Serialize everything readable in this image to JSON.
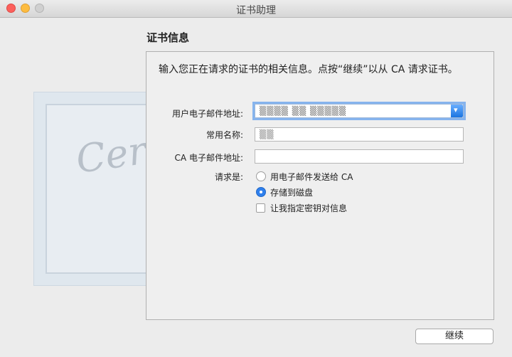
{
  "window": {
    "title": "证书助理"
  },
  "section": {
    "title": "证书信息"
  },
  "intro": "输入您正在请求的证书的相关信息。点按“继续”以从 CA 请求证书。",
  "form": {
    "email_label": "用户电子邮件地址:",
    "email_value": "▒▒▒▒ ▒▒ ▒▒▒▒▒",
    "name_label": "常用名称:",
    "name_value": "▒▒",
    "ca_email_label": "CA 电子邮件地址:",
    "ca_email_value": "",
    "request_label": "请求是:",
    "options": [
      {
        "label": "用电子邮件发送给 CA",
        "selected": false
      },
      {
        "label": "存储到磁盘",
        "selected": true
      }
    ],
    "checkbox_label": "让我指定密钥对信息",
    "checkbox_checked": false
  },
  "background": {
    "cert_word": "Certificate"
  },
  "buttons": {
    "continue": "继续"
  },
  "colors": {
    "accent": "#2f80ed",
    "close": "#fc605c",
    "minimize": "#fdbc40"
  }
}
